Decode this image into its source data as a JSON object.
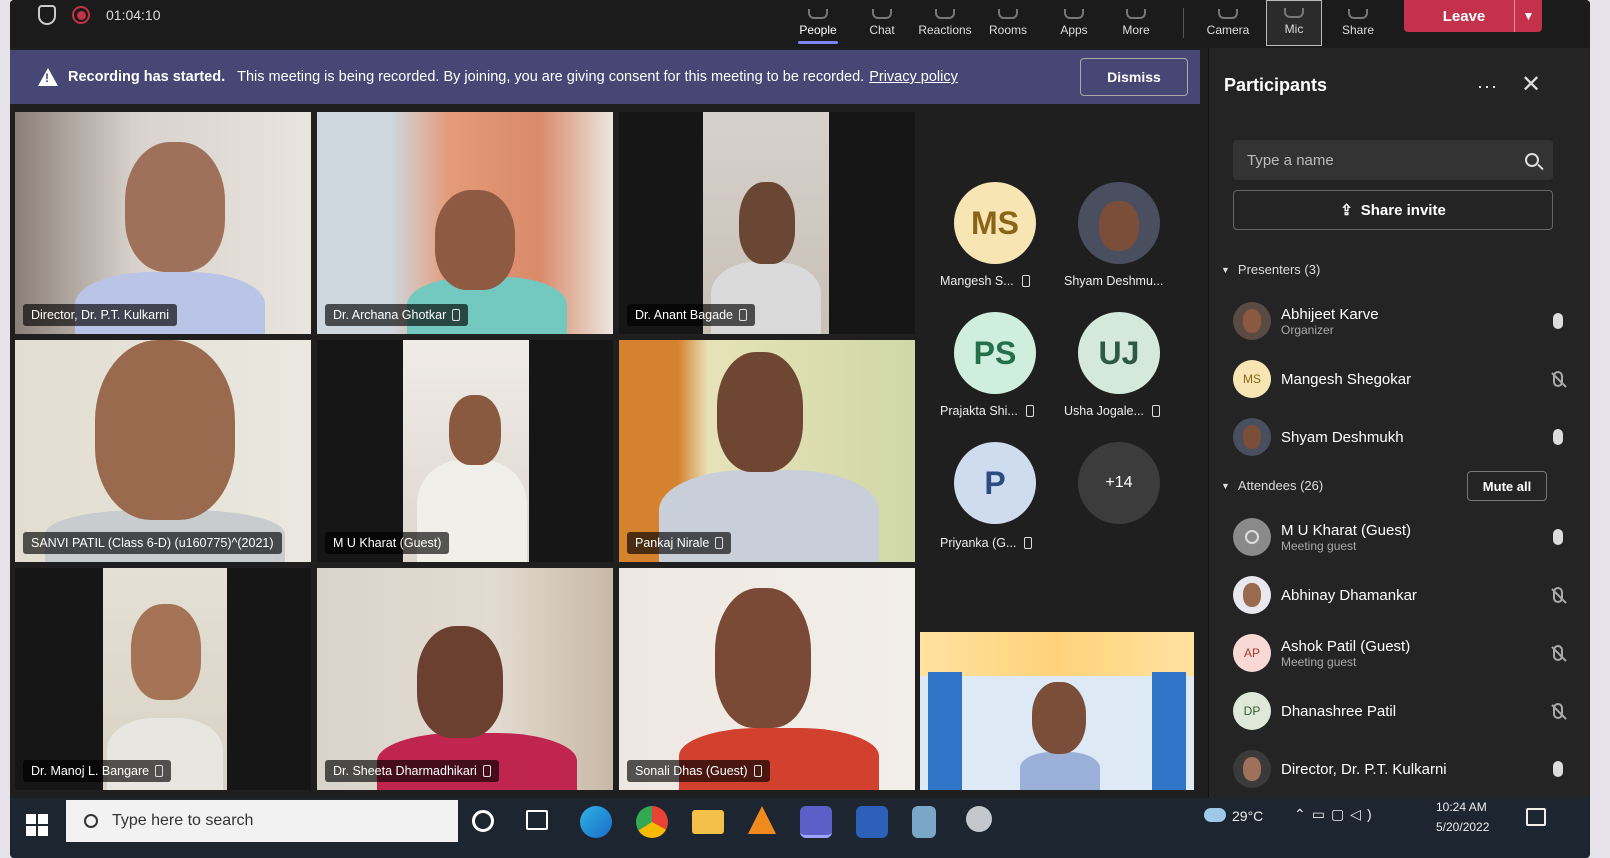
{
  "topbar": {
    "timer": "01:04:10",
    "buttons": [
      "People",
      "Chat",
      "Reactions",
      "Rooms",
      "Apps",
      "More",
      "Camera",
      "Mic",
      "Share"
    ],
    "leave": "Leave"
  },
  "banner": {
    "bold": "Recording has started.",
    "message": "This meeting is being recorded. By joining, you are giving consent for this meeting to be recorded.",
    "link": "Privacy policy",
    "dismiss": "Dismiss"
  },
  "tiles": [
    {
      "name": "Director, Dr. P.T. Kulkarni"
    },
    {
      "name": "Dr. Archana Ghotkar"
    },
    {
      "name": "Dr. Anant Bagade"
    },
    {
      "name": "SANVI PATIL (Class 6-D) (u160775)^(2021)"
    },
    {
      "name": "M U Kharat (Guest)"
    },
    {
      "name": "Pankaj Nirale"
    },
    {
      "name": "Dr. Manoj L. Bangare"
    },
    {
      "name": "Dr. Sheeta Dharmadhikari"
    },
    {
      "name": "Sonali Dhas (Guest)"
    }
  ],
  "avatars": [
    {
      "initials": "MS",
      "name": "Mangesh S..."
    },
    {
      "initials": "",
      "name": "Shyam Deshmu..."
    },
    {
      "initials": "PS",
      "name": "Prajakta Shi..."
    },
    {
      "initials": "UJ",
      "name": "Usha Jogale..."
    },
    {
      "initials": "P",
      "name": "Priyanka (G..."
    },
    {
      "initials": "+14",
      "name": ""
    }
  ],
  "panel": {
    "title": "Participants",
    "more": "···",
    "close": "✕",
    "search_placeholder": "Type a name",
    "share_invite": "Share invite",
    "presenters_label": "Presenters (3)",
    "attendees_label": "Attendees (26)",
    "mute_all": "Mute all",
    "presenters": [
      {
        "name": "Abhijeet Karve",
        "sub": "Organizer",
        "initials": "",
        "mic": "on"
      },
      {
        "name": "Mangesh Shegokar",
        "sub": "",
        "initials": "MS",
        "mic": "off"
      },
      {
        "name": "Shyam Deshmukh",
        "sub": "",
        "initials": "",
        "mic": "on"
      }
    ],
    "attendees": [
      {
        "name": "M U Kharat (Guest)",
        "sub": "Meeting guest",
        "initials": "",
        "mic": "on"
      },
      {
        "name": "Abhinay Dhamankar",
        "sub": "",
        "initials": "",
        "mic": "off"
      },
      {
        "name": "Ashok Patil (Guest)",
        "sub": "Meeting guest",
        "initials": "AP",
        "mic": "off"
      },
      {
        "name": "Dhanashree Patil",
        "sub": "",
        "initials": "DP",
        "mic": "off"
      },
      {
        "name": "Director, Dr. P.T. Kulkarni",
        "sub": "",
        "initials": "",
        "mic": "on"
      }
    ]
  },
  "taskbar": {
    "search_placeholder": "Type here to search",
    "temperature": "29°C",
    "time": "10:24 AM",
    "date": "5/20/2022"
  }
}
